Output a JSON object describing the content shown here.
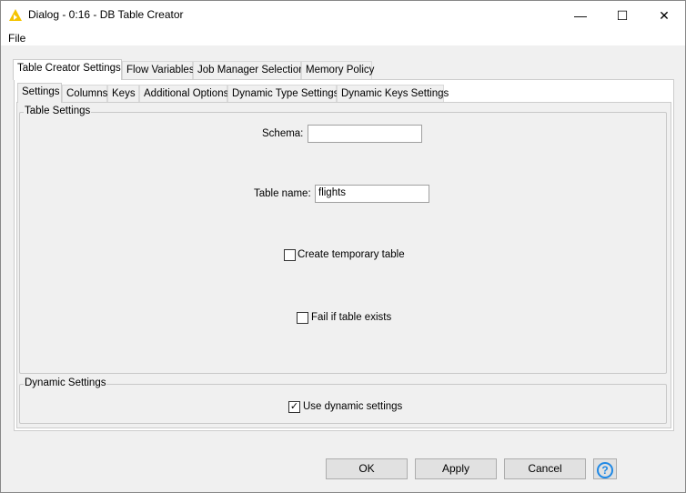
{
  "window": {
    "title": "Dialog - 0:16 - DB Table Creator",
    "icon": "knime-triangle-icon",
    "minimize": "—",
    "maximize": "☐",
    "close": "✕"
  },
  "menu": {
    "file": "File"
  },
  "outer_tabs": [
    {
      "label": "Table Creator Settings",
      "selected": true
    },
    {
      "label": "Flow Variables"
    },
    {
      "label": "Job Manager Selection"
    },
    {
      "label": "Memory Policy"
    }
  ],
  "inner_tabs": [
    {
      "label": "Settings",
      "selected": true
    },
    {
      "label": "Columns"
    },
    {
      "label": "Keys"
    },
    {
      "label": "Additional Options"
    },
    {
      "label": "Dynamic Type Settings"
    },
    {
      "label": "Dynamic Keys Settings"
    }
  ],
  "table_settings": {
    "legend": "Table Settings",
    "schema_label": "Schema:",
    "schema_value": "",
    "table_name_label": "Table name:",
    "table_name_value": "flights",
    "temp_label": "Create temporary table",
    "temp_checked": false,
    "fail_label": "Fail if table exists",
    "fail_checked": false
  },
  "dynamic_settings": {
    "legend": "Dynamic Settings",
    "use_label": "Use dynamic settings",
    "use_checked": true
  },
  "buttons": {
    "ok": "OK",
    "apply": "Apply",
    "cancel": "Cancel",
    "help": "?"
  },
  "colors": {
    "help": "#1e88e5",
    "icon": "#f5c400"
  }
}
